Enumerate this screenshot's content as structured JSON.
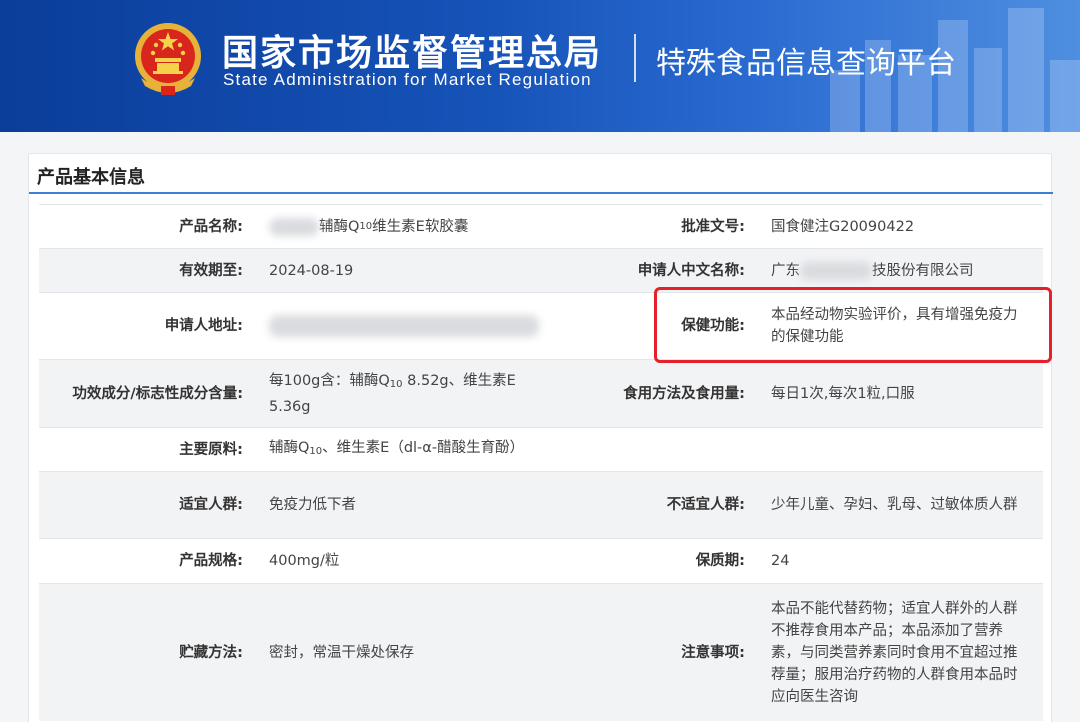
{
  "header": {
    "org_cn": "国家市场监督管理总局",
    "org_en": "State Administration  for  Market Regulation",
    "platform": "特殊食品信息查询平台",
    "emblem_icon": "national-emblem-icon",
    "colors": {
      "banner": "#1653b8",
      "accent": "#3e7ed6",
      "highlight": "#e4202a"
    }
  },
  "section": {
    "title": "产品基本信息"
  },
  "rows": [
    {
      "label1": "产品名称:",
      "value1_pre": "",
      "value1_mid": "辅酶Q",
      "value1_sub": "10",
      "value1_post": "维生素E软胶囊",
      "label2": "批准文号:",
      "value2": "国食健注G20090422"
    },
    {
      "label1": "有效期至:",
      "value1": "2024-08-19",
      "label2": "申请人中文名称:",
      "value2_pre": "广东",
      "value2_post": "技股份有限公司"
    },
    {
      "label1": "申请人地址:",
      "value1": "",
      "label2": "保健功能:",
      "value2": "本品经动物实验评价，具有增强免疫力的保健功能"
    },
    {
      "label1": "功效成分/标志性成分含量:",
      "value1_pre": "每100g含：辅酶Q",
      "value1_sub": "10",
      "value1_post": " 8.52g、维生素E 5.36g",
      "label2": "食用方法及食用量:",
      "value2": "每日1次,每次1粒,口服"
    },
    {
      "label1": "主要原料:",
      "value1_pre": "辅酶Q",
      "value1_sub": "10",
      "value1_post": "、维生素E（dl-α-醋酸生育酚）",
      "label2": "",
      "value2": ""
    },
    {
      "label1": "适宜人群:",
      "value1": "免疫力低下者",
      "label2": "不适宜人群:",
      "value2": "少年儿童、孕妇、乳母、过敏体质人群"
    },
    {
      "label1": "产品规格:",
      "value1": "400mg/粒",
      "label2": "保质期:",
      "value2": "24"
    },
    {
      "label1": "贮藏方法:",
      "value1": "密封，常温干燥处保存",
      "label2": "注意事项:",
      "value2": "本品不能代替药物；适宜人群外的人群不推荐食用本产品；本品添加了营养素，与同类营养素同时食用不宜超过推荐量；服用治疗药物的人群食用本品时应向医生咨询"
    }
  ]
}
